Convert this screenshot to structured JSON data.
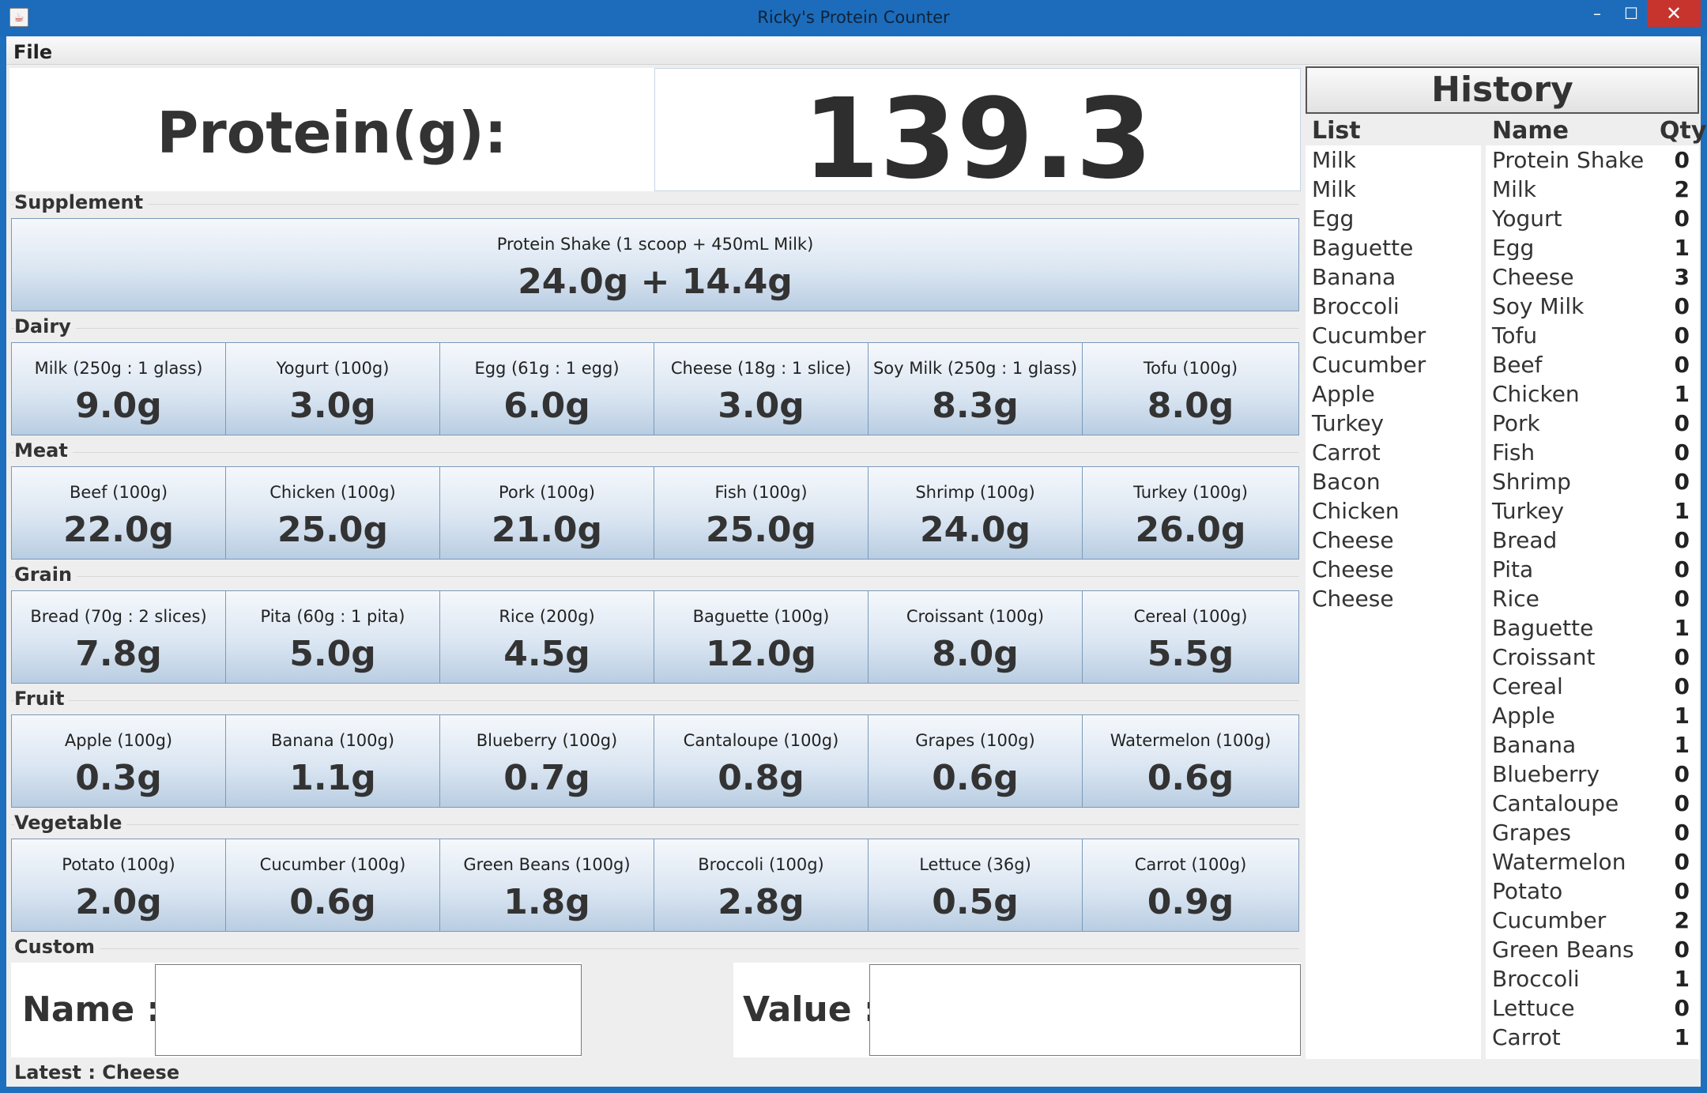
{
  "window": {
    "title": "Ricky's Protein Counter"
  },
  "menu": {
    "file": "File"
  },
  "protein": {
    "label": "Protein(g):",
    "total": "139.3"
  },
  "sections": [
    {
      "label": "Supplement",
      "items": [
        {
          "name": "Protein Shake (1 scoop + 450mL Milk)",
          "value": "24.0g + 14.4g"
        }
      ]
    },
    {
      "label": "Dairy",
      "items": [
        {
          "name": "Milk (250g : 1 glass)",
          "value": "9.0g"
        },
        {
          "name": "Yogurt (100g)",
          "value": "3.0g"
        },
        {
          "name": "Egg (61g : 1 egg)",
          "value": "6.0g"
        },
        {
          "name": "Cheese (18g : 1 slice)",
          "value": "3.0g"
        },
        {
          "name": "Soy Milk (250g : 1 glass)",
          "value": "8.3g"
        },
        {
          "name": "Tofu (100g)",
          "value": "8.0g"
        }
      ]
    },
    {
      "label": "Meat",
      "items": [
        {
          "name": "Beef (100g)",
          "value": "22.0g"
        },
        {
          "name": "Chicken (100g)",
          "value": "25.0g"
        },
        {
          "name": "Pork (100g)",
          "value": "21.0g"
        },
        {
          "name": "Fish (100g)",
          "value": "25.0g"
        },
        {
          "name": "Shrimp (100g)",
          "value": "24.0g"
        },
        {
          "name": "Turkey (100g)",
          "value": "26.0g"
        }
      ]
    },
    {
      "label": "Grain",
      "items": [
        {
          "name": "Bread (70g : 2 slices)",
          "value": "7.8g"
        },
        {
          "name": "Pita (60g : 1 pita)",
          "value": "5.0g"
        },
        {
          "name": "Rice (200g)",
          "value": "4.5g"
        },
        {
          "name": "Baguette (100g)",
          "value": "12.0g"
        },
        {
          "name": "Croissant (100g)",
          "value": "8.0g"
        },
        {
          "name": "Cereal (100g)",
          "value": "5.5g"
        }
      ]
    },
    {
      "label": "Fruit",
      "items": [
        {
          "name": "Apple (100g)",
          "value": "0.3g"
        },
        {
          "name": "Banana (100g)",
          "value": "1.1g"
        },
        {
          "name": "Blueberry (100g)",
          "value": "0.7g"
        },
        {
          "name": "Cantaloupe (100g)",
          "value": "0.8g"
        },
        {
          "name": "Grapes (100g)",
          "value": "0.6g"
        },
        {
          "name": "Watermelon (100g)",
          "value": "0.6g"
        }
      ]
    },
    {
      "label": "Vegetable",
      "items": [
        {
          "name": "Potato (100g)",
          "value": "2.0g"
        },
        {
          "name": "Cucumber (100g)",
          "value": "0.6g"
        },
        {
          "name": "Green Beans (100g)",
          "value": "1.8g"
        },
        {
          "name": "Broccoli (100g)",
          "value": "2.8g"
        },
        {
          "name": "Lettuce (36g)",
          "value": "0.5g"
        },
        {
          "name": "Carrot (100g)",
          "value": "0.9g"
        }
      ]
    }
  ],
  "custom": {
    "label": "Custom",
    "name_label": "Name :",
    "value_label": "Value :",
    "name_value": "",
    "value_value": ""
  },
  "status": "Latest : Cheese",
  "history": {
    "title": "History",
    "list_header": "List",
    "name_header": "Name",
    "qty_header": "Qty",
    "list": [
      "Milk",
      "Milk",
      "Egg",
      "Baguette",
      "Banana",
      "Broccoli",
      "Cucumber",
      "Cucumber",
      "Apple",
      "Turkey",
      "Carrot",
      "Bacon",
      "Chicken",
      "Cheese",
      "Cheese",
      "Cheese"
    ],
    "counts": [
      {
        "name": "Protein Shake",
        "qty": "0"
      },
      {
        "name": "Milk",
        "qty": "2"
      },
      {
        "name": "Yogurt",
        "qty": "0"
      },
      {
        "name": "Egg",
        "qty": "1"
      },
      {
        "name": "Cheese",
        "qty": "3"
      },
      {
        "name": "Soy Milk",
        "qty": "0"
      },
      {
        "name": "Tofu",
        "qty": "0"
      },
      {
        "name": "Beef",
        "qty": "0"
      },
      {
        "name": "Chicken",
        "qty": "1"
      },
      {
        "name": "Pork",
        "qty": "0"
      },
      {
        "name": "Fish",
        "qty": "0"
      },
      {
        "name": "Shrimp",
        "qty": "0"
      },
      {
        "name": "Turkey",
        "qty": "1"
      },
      {
        "name": "Bread",
        "qty": "0"
      },
      {
        "name": "Pita",
        "qty": "0"
      },
      {
        "name": "Rice",
        "qty": "0"
      },
      {
        "name": "Baguette",
        "qty": "1"
      },
      {
        "name": "Croissant",
        "qty": "0"
      },
      {
        "name": "Cereal",
        "qty": "0"
      },
      {
        "name": "Apple",
        "qty": "1"
      },
      {
        "name": "Banana",
        "qty": "1"
      },
      {
        "name": "Blueberry",
        "qty": "0"
      },
      {
        "name": "Cantaloupe",
        "qty": "0"
      },
      {
        "name": "Grapes",
        "qty": "0"
      },
      {
        "name": "Watermelon",
        "qty": "0"
      },
      {
        "name": "Potato",
        "qty": "0"
      },
      {
        "name": "Cucumber",
        "qty": "2"
      },
      {
        "name": "Green Beans",
        "qty": "0"
      },
      {
        "name": "Broccoli",
        "qty": "1"
      },
      {
        "name": "Lettuce",
        "qty": "0"
      },
      {
        "name": "Carrot",
        "qty": "1"
      }
    ]
  }
}
